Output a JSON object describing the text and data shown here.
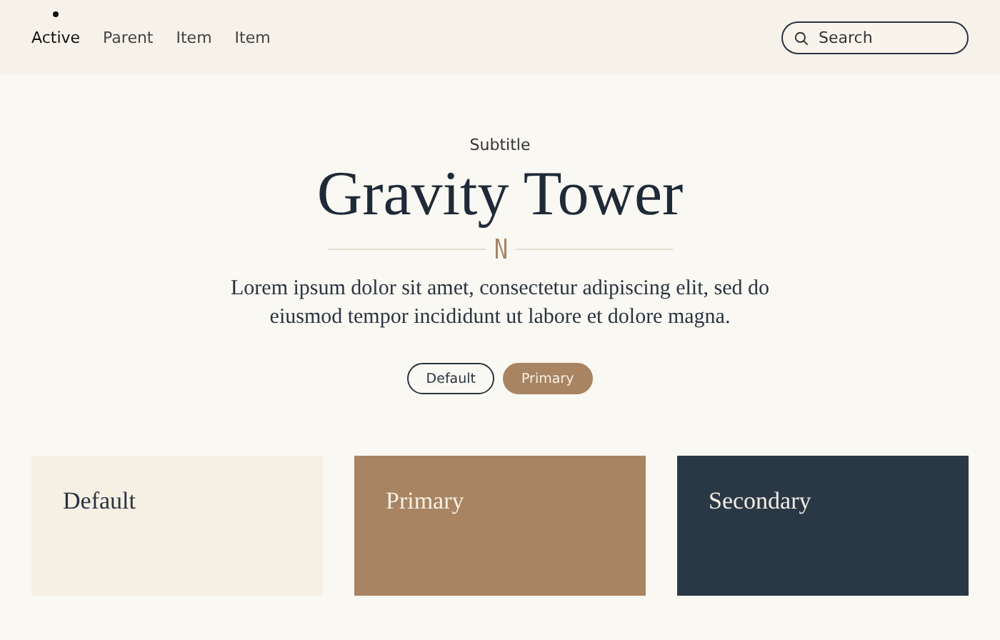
{
  "nav": {
    "items": [
      {
        "label": "Active",
        "selected": true
      },
      {
        "label": "Parent",
        "selected": false
      },
      {
        "label": "Item",
        "selected": false
      },
      {
        "label": "Item",
        "selected": false
      }
    ],
    "search": {
      "placeholder": "Search"
    }
  },
  "hero": {
    "subtitle": "Subtitle",
    "title": "Gravity Tower",
    "text": "Lorem ipsum dolor sit amet, consectetur adipiscing elit, sed do eiusmod tempor incididunt ut labore et dolore magna.",
    "buttons": [
      {
        "label": "Default",
        "kind": "default"
      },
      {
        "label": "Primary",
        "kind": "primary"
      }
    ]
  },
  "cards": [
    {
      "title": "Default",
      "kind": "default"
    },
    {
      "title": "Primary",
      "kind": "primary"
    },
    {
      "title": "Secondary",
      "kind": "secondary"
    }
  ]
}
